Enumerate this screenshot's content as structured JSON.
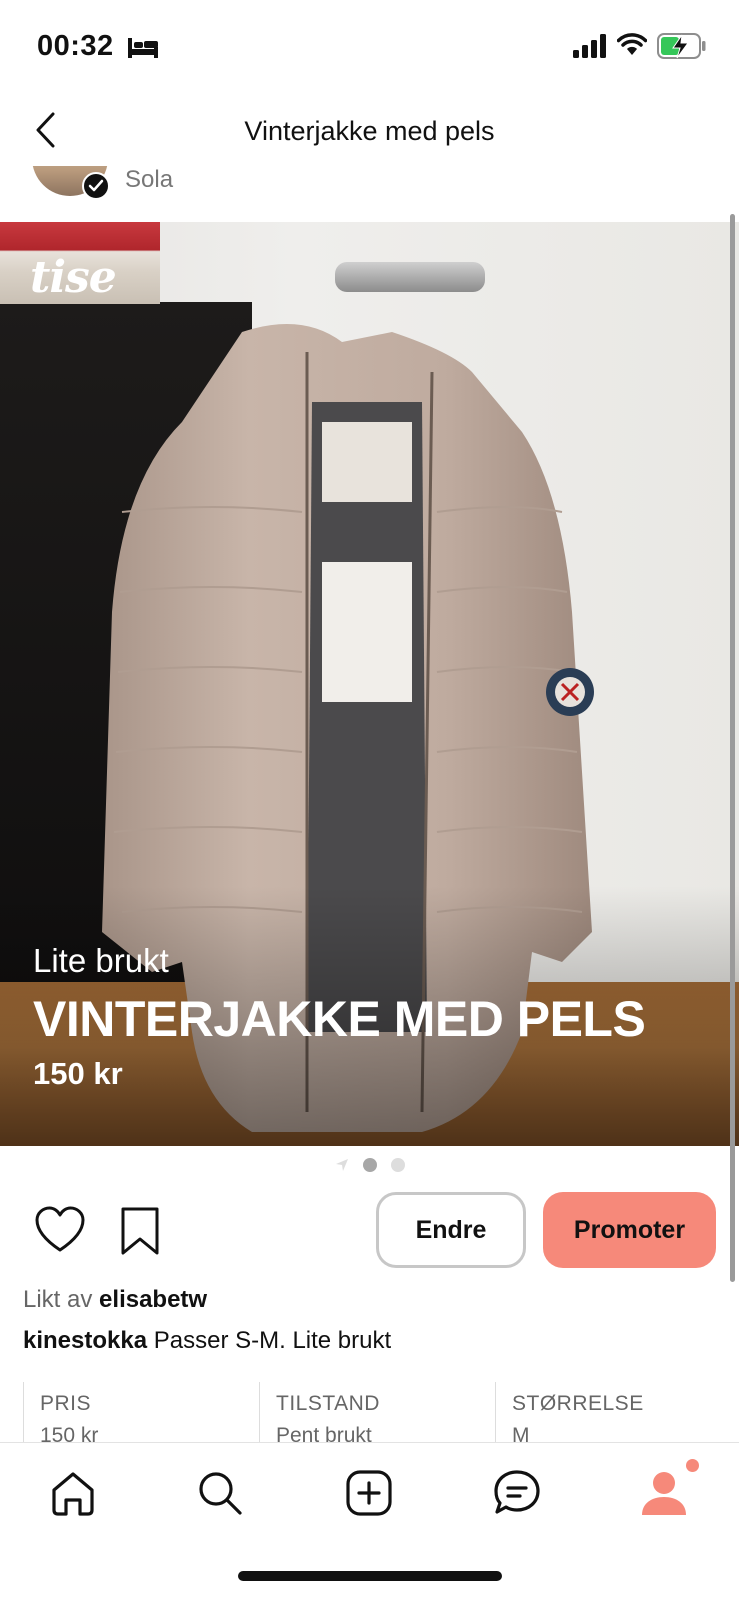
{
  "status_bar": {
    "time": "00:32",
    "icons": [
      "bed-icon",
      "signal-icon",
      "wifi-icon",
      "battery-charging-icon"
    ],
    "battery_color": "#35c759"
  },
  "header": {
    "title": "Vinterjakke med pels",
    "back_icon": "chevron-left-icon"
  },
  "seller": {
    "location": "Sola"
  },
  "listing": {
    "watermark": "tise",
    "condition": "Lite brukt",
    "title": "VINTERJAKKE MED PELS",
    "price": "150 kr",
    "pager": {
      "count": 2,
      "active": 1
    }
  },
  "actions": {
    "like_icon": "heart-icon",
    "save_icon": "bookmark-icon",
    "edit_label": "Endre",
    "promote_label": "Promoter",
    "promote_color": "#f6897a"
  },
  "social": {
    "liked_prefix": "Likt av",
    "liked_user": "elisabetw",
    "author": "kinestokka",
    "description": "Passer S-M. Lite brukt"
  },
  "details": [
    {
      "label": "PRIS",
      "value": "150 kr"
    },
    {
      "label": "TILSTAND",
      "value": "Pent brukt"
    },
    {
      "label": "STØRRELSE",
      "value": "M"
    }
  ],
  "bottom_nav": {
    "items": [
      "home-icon",
      "search-icon",
      "add-icon",
      "messages-icon",
      "profile-icon"
    ],
    "active_color": "#f6897a"
  }
}
